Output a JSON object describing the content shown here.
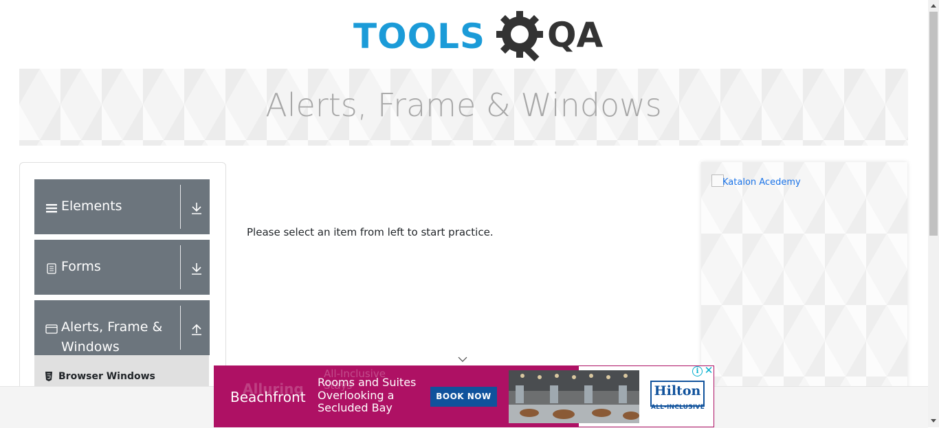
{
  "logo": {
    "text_part1": "TOOLS",
    "text_part2": "QA",
    "colors": {
      "primary": "#1b9bd8",
      "secondary": "#333333"
    }
  },
  "banner": {
    "title": "Alerts, Frame & Windows"
  },
  "sidebar": {
    "groups": [
      {
        "label": "Elements",
        "icon": "hamburger-icon",
        "arrow": "download-arrow-icon",
        "expanded": false
      },
      {
        "label": "Forms",
        "icon": "form-icon",
        "arrow": "download-arrow-icon",
        "expanded": false
      },
      {
        "label": "Alerts, Frame & Windows",
        "label_line1": "Alerts, Frame &",
        "label_line2": "Windows",
        "icon": "window-icon",
        "arrow": "upload-arrow-icon",
        "expanded": true
      }
    ],
    "sub_items": [
      {
        "label": "Browser Windows",
        "icon": "html5-icon"
      }
    ],
    "colors": {
      "group_bg": "#6c757d",
      "subitem_bg": "#e0e0e0"
    }
  },
  "main": {
    "message": "Please select an item from left to start practice."
  },
  "right_ad": {
    "alt_text": "Katalon Acedemy"
  },
  "bottom_ad": {
    "ghost_text_1": "Alluring",
    "ghost_text_2": "All-Inclusive Stays",
    "headline": "Beachfront",
    "subheadline": "Rooms and Suites Overlooking a Secluded Bay",
    "cta": "BOOK NOW",
    "brand": "Hilton",
    "brand_tagline": "ALL-INCLUSIVE",
    "colors": {
      "panel": "#ae1164",
      "brand": "#10529c"
    }
  }
}
